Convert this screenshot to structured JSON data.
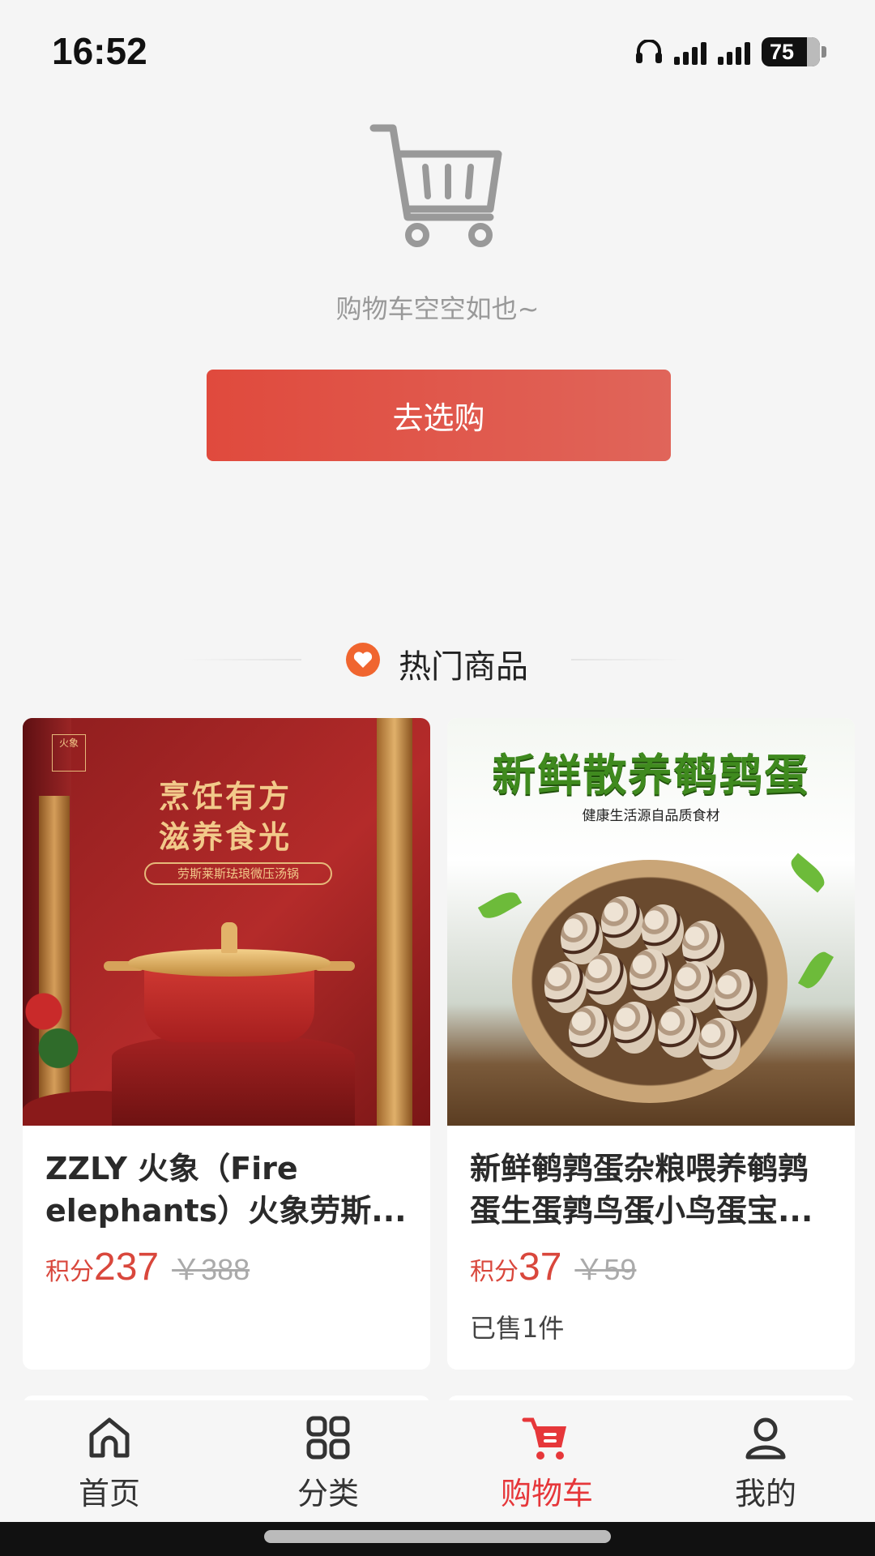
{
  "status_bar": {
    "time": "16:52",
    "battery": "75"
  },
  "cart": {
    "empty_text": "购物车空空如也~",
    "go_shop_label": "去选购"
  },
  "section": {
    "title": "热门商品"
  },
  "products": [
    {
      "name": "ZZLY 火象（Fire elephants）火象劳斯...",
      "points_label": "积分",
      "points": "237",
      "original_price": "￥388",
      "sold": "",
      "image": {
        "headline_1": "烹饪有方",
        "headline_2": "滋养食光",
        "sub": "劳斯莱斯珐琅微压汤锅",
        "logo": "火象"
      }
    },
    {
      "name": "新鲜鹌鹑蛋杂粮喂养鹌鹑蛋生蛋鹑鸟蛋小鸟蛋宝...",
      "points_label": "积分",
      "points": "37",
      "original_price": "￥59",
      "sold": "已售1件",
      "image": {
        "headline": "新鲜散养鹌鹑蛋",
        "sub": "健康生活源自品质食材"
      }
    }
  ],
  "nav": [
    {
      "label": "首页",
      "icon": "home-icon",
      "active": false
    },
    {
      "label": "分类",
      "icon": "grid-icon",
      "active": false
    },
    {
      "label": "购物车",
      "icon": "cart-icon",
      "active": true
    },
    {
      "label": "我的",
      "icon": "user-icon",
      "active": false
    }
  ],
  "colors": {
    "accent": "#e6373a",
    "button_start": "#e04a3d",
    "button_end": "#e0655a",
    "price": "#d9473c",
    "heart": "#f0652f"
  }
}
